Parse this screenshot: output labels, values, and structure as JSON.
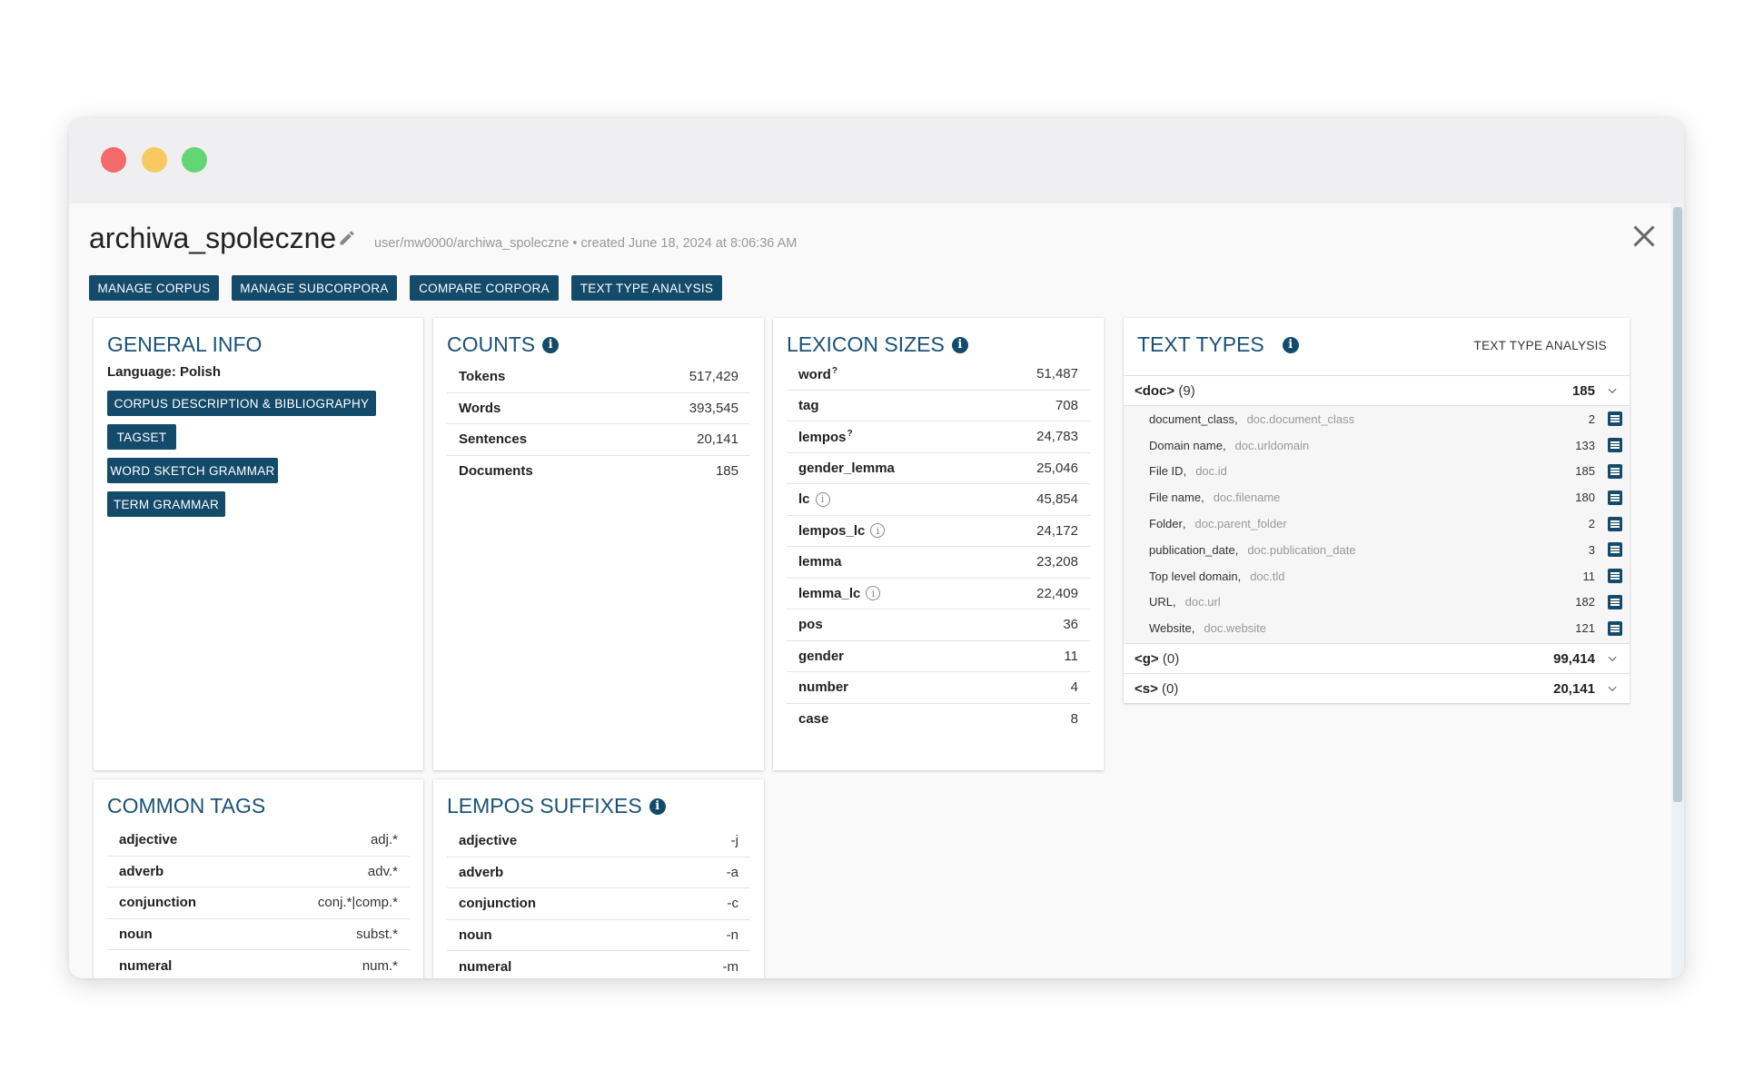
{
  "corpus": {
    "name": "archiwa_spoleczne",
    "meta": "user/mw0000/archiwa_spoleczne • created June 18, 2024 at 8:06:36 AM"
  },
  "buttons": {
    "manage_corpus": "MANAGE CORPUS",
    "manage_subcorpora": "MANAGE SUBCORPORA",
    "compare_corpora": "COMPARE CORPORA",
    "text_type_analysis": "TEXT TYPE ANALYSIS"
  },
  "general_info": {
    "title": "GENERAL INFO",
    "language": "Language: Polish",
    "buttons": [
      "CORPUS DESCRIPTION & BIBLIOGRAPHY",
      "TAGSET",
      "WORD SKETCH GRAMMAR",
      "TERM GRAMMAR"
    ]
  },
  "counts": {
    "title": "COUNTS",
    "rows": [
      {
        "label": "Tokens",
        "value": "517,429"
      },
      {
        "label": "Words",
        "value": "393,545"
      },
      {
        "label": "Sentences",
        "value": "20,141"
      },
      {
        "label": "Documents",
        "value": "185"
      }
    ]
  },
  "lexicon": {
    "title": "LEXICON SIZES",
    "rows": [
      {
        "label": "word",
        "sup": "?",
        "value": "51,487"
      },
      {
        "label": "tag",
        "value": "708"
      },
      {
        "label": "lempos",
        "sup": "?",
        "value": "24,783"
      },
      {
        "label": "gender_lemma",
        "value": "25,046"
      },
      {
        "label": "lc",
        "info": "i",
        "value": "45,854"
      },
      {
        "label": "lempos_lc",
        "info": "i",
        "value": "24,172"
      },
      {
        "label": "lemma",
        "value": "23,208"
      },
      {
        "label": "lemma_lc",
        "info": "i",
        "value": "22,409"
      },
      {
        "label": "pos",
        "value": "36"
      },
      {
        "label": "gender",
        "value": "11"
      },
      {
        "label": "number",
        "value": "4"
      },
      {
        "label": "case",
        "value": "8"
      }
    ]
  },
  "text_types": {
    "title": "TEXT TYPES",
    "link": "TEXT TYPE ANALYSIS",
    "doc": {
      "name": "<doc>",
      "count": "(9)",
      "value": "185"
    },
    "attrs": [
      {
        "label": "document_class",
        "attr": "doc.document_class",
        "value": "2"
      },
      {
        "label": "Domain name",
        "attr": "doc.urldomain",
        "value": "133"
      },
      {
        "label": "File ID",
        "attr": "doc.id",
        "value": "185"
      },
      {
        "label": "File name",
        "attr": "doc.filename",
        "value": "180"
      },
      {
        "label": "Folder",
        "attr": "doc.parent_folder",
        "value": "2"
      },
      {
        "label": "publication_date",
        "attr": "doc.publication_date",
        "value": "3"
      },
      {
        "label": "Top level domain",
        "attr": "doc.tld",
        "value": "11"
      },
      {
        "label": "URL",
        "attr": "doc.url",
        "value": "182"
      },
      {
        "label": "Website",
        "attr": "doc.website",
        "value": "121"
      }
    ],
    "g": {
      "name": "<g>",
      "count": "(0)",
      "value": "99,414"
    },
    "s": {
      "name": "<s>",
      "count": "(0)",
      "value": "20,141"
    }
  },
  "common_tags": {
    "title": "COMMON TAGS",
    "rows": [
      {
        "label": "adjective",
        "value": "adj.*"
      },
      {
        "label": "adverb",
        "value": "adv.*"
      },
      {
        "label": "conjunction",
        "value": "conj.*|comp.*"
      },
      {
        "label": "noun",
        "value": "subst.*"
      },
      {
        "label": "numeral",
        "value": "num.*"
      }
    ]
  },
  "lempos_suffixes": {
    "title": "LEMPOS SUFFIXES",
    "rows": [
      {
        "label": "adjective",
        "value": "-j"
      },
      {
        "label": "adverb",
        "value": "-a"
      },
      {
        "label": "conjunction",
        "value": "-c"
      },
      {
        "label": "noun",
        "value": "-n"
      },
      {
        "label": "numeral",
        "value": "-m"
      }
    ]
  },
  "colors": {
    "accent": "#144b6a",
    "title": "#1a5277"
  }
}
